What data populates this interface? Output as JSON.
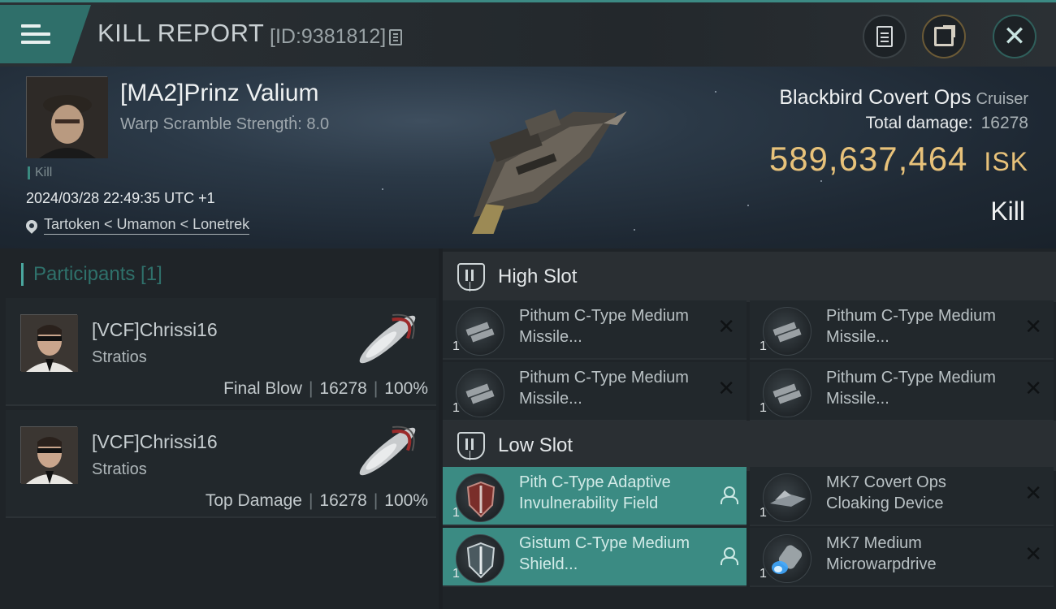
{
  "header": {
    "title": "KILL REPORT",
    "report_id": "[ID:9381812]"
  },
  "icons": {
    "menu": "hamburger-icon",
    "notes": "notes-icon",
    "share": "share-icon",
    "close": "close-icon",
    "copy": "copy-icon",
    "location": "location-pin-icon",
    "slot": "slot-icon",
    "pilot": "pilot-icon"
  },
  "victim": {
    "name": "[MA2]Prinz Valium",
    "scramble": "Warp Scramble Strength: 8.0",
    "tag": "Kill",
    "datetime": "2024/03/28 22:49:35 UTC +1",
    "location": "Tartoken < Umamon < Lonetrek",
    "ship": "Blackbird Covert Ops",
    "ship_class": "Cruiser",
    "total_damage_label": "Total damage:",
    "total_damage": "16278",
    "isk_value": "589,637,464",
    "isk_unit": "ISK",
    "result": "Kill"
  },
  "participants": {
    "header": "Participants [1]",
    "rows": [
      {
        "name": "[VCF]Chrissi16",
        "ship": "Stratios",
        "role": "Final Blow",
        "damage": "16278",
        "percent": "100%"
      },
      {
        "name": "[VCF]Chrissi16",
        "ship": "Stratios",
        "role": "Top Damage",
        "damage": "16278",
        "percent": "100%"
      }
    ]
  },
  "fitting": {
    "high": {
      "label": "High Slot",
      "modules": [
        {
          "name": "Pithum C-Type Medium Missile...",
          "qty": "1"
        },
        {
          "name": "Pithum C-Type Medium Missile...",
          "qty": "1"
        },
        {
          "name": "Pithum C-Type Medium Missile...",
          "qty": "1"
        },
        {
          "name": "Pithum C-Type Medium Missile...",
          "qty": "1"
        }
      ]
    },
    "low": {
      "label": "Low Slot",
      "modules": [
        {
          "name": "Pith C-Type Adaptive Invulnerability Field",
          "qty": "1"
        },
        {
          "name": "MK7 Covert Ops Cloaking Device",
          "qty": "1"
        },
        {
          "name": "Gistum C-Type Medium Shield...",
          "qty": "1"
        },
        {
          "name": "MK7 Medium Microwarpdrive",
          "qty": "1"
        }
      ]
    }
  },
  "colors": {
    "accent": "#3b8b83",
    "isk": "#e8c27a"
  }
}
